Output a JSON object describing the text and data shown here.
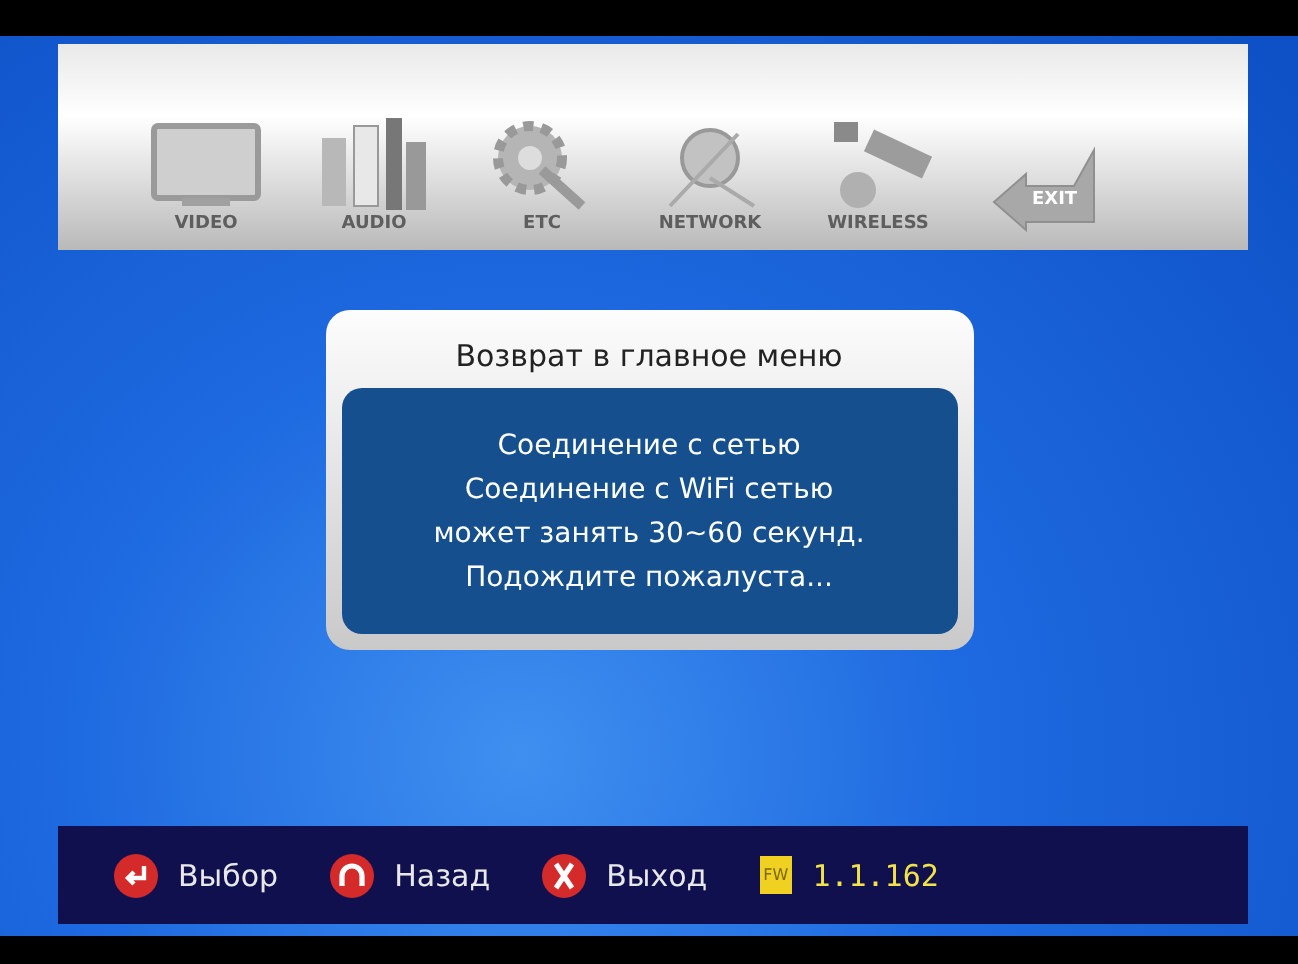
{
  "menu": [
    {
      "label": "VIDEO",
      "kind": "video",
      "disabled": true
    },
    {
      "label": "AUDIO",
      "kind": "audio",
      "disabled": true
    },
    {
      "label": "ETC",
      "kind": "etc",
      "disabled": true
    },
    {
      "label": "NETWORK",
      "kind": "network",
      "disabled": true
    },
    {
      "label": "WIRELESS",
      "kind": "wireless",
      "disabled": true
    },
    {
      "label": "EXIT",
      "kind": "exit",
      "disabled": true
    }
  ],
  "dialog": {
    "title": "Возврат в главное меню",
    "lines": [
      "Соединение с сетью",
      "Соединение с WiFi сетью",
      "может занять 30~60 секунд.",
      "Подождите пожалуста..."
    ]
  },
  "footer": [
    {
      "kind": "enter",
      "label": "Выбор"
    },
    {
      "kind": "back",
      "label": "Назад"
    },
    {
      "kind": "exit",
      "label": "Выход"
    },
    {
      "kind": "fw",
      "badge": "FW",
      "label": "1.1.162"
    }
  ]
}
